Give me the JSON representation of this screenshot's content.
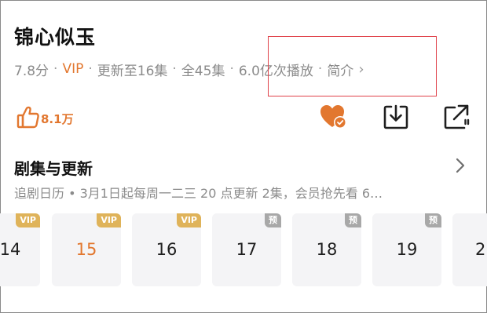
{
  "drama": {
    "title": "锦心似玉",
    "rating": "7.8分",
    "vip": "VIP",
    "update": "更新至16集",
    "total": "全45集",
    "plays": "6.0亿次播放",
    "intro": "简介",
    "sep": "·",
    "chevron": "›"
  },
  "actions": {
    "likes": "8.1万",
    "like_icon": "thumbs-up-icon",
    "follow_icon": "heart-check-icon",
    "download_icon": "download-icon",
    "share_icon": "share-icon"
  },
  "episodes_section": {
    "title": "剧集与更新",
    "subtitle": "追剧日历 • 3月1日起每周一二三 20 点更新 2集，会员抢先看 6…",
    "items": [
      {
        "number": "14",
        "badge": "VIP",
        "badge_type": "vip"
      },
      {
        "number": "15",
        "badge": "VIP",
        "badge_type": "vip"
      },
      {
        "number": "16",
        "badge": "VIP",
        "badge_type": "vip"
      },
      {
        "number": "17",
        "badge": "预",
        "badge_type": "pre"
      },
      {
        "number": "18",
        "badge": "预",
        "badge_type": "pre"
      },
      {
        "number": "19",
        "badge": "预",
        "badge_type": "pre"
      },
      {
        "number": "2",
        "badge": "",
        "badge_type": "none"
      }
    ]
  },
  "colors": {
    "accent": "#e2772f",
    "highlight_box": "#e0424a",
    "vip_badge": "#dfb35a",
    "preview_badge": "#a8a8a8"
  }
}
